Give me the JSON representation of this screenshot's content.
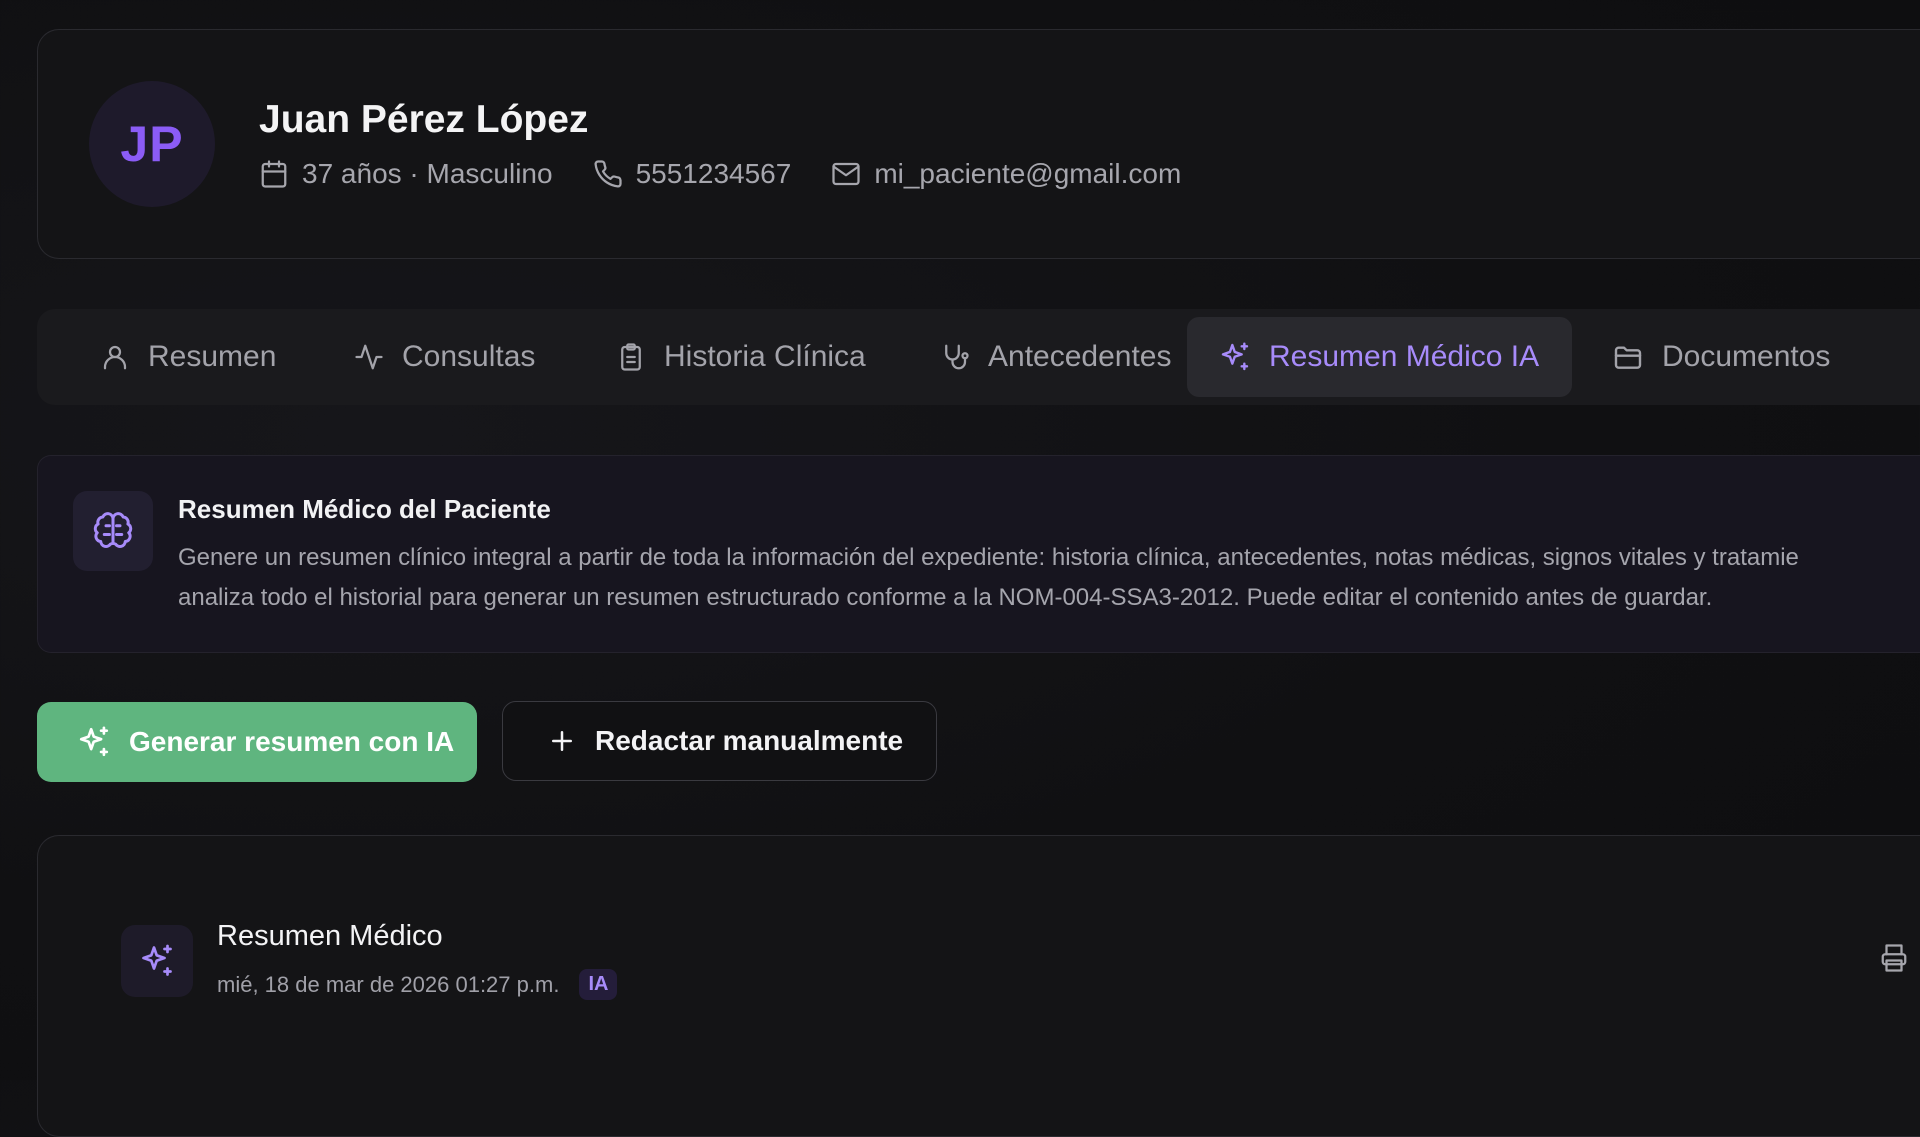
{
  "patient": {
    "initials": "JP",
    "name": "Juan Pérez López",
    "age_gender": "37 años · Masculino",
    "phone": "5551234567",
    "email": "mi_paciente@gmail.com"
  },
  "tabs": [
    {
      "label": "Resumen",
      "icon": "user-icon",
      "active": false
    },
    {
      "label": "Consultas",
      "icon": "activity-icon",
      "active": false
    },
    {
      "label": "Historia Clínica",
      "icon": "clipboard-icon",
      "active": false
    },
    {
      "label": "Antecedentes",
      "icon": "stethoscope-icon",
      "active": false
    },
    {
      "label": "Resumen Médico IA",
      "icon": "sparkles-icon",
      "active": true
    },
    {
      "label": "Documentos",
      "icon": "folder-icon",
      "active": false
    }
  ],
  "info": {
    "title": "Resumen Médico del Paciente",
    "line1": "Genere un resumen clínico integral a partir de toda la información del expediente: historia clínica, antecedentes, notas médicas, signos vitales y tratamie",
    "line2": "analiza todo el historial para generar un resumen estructurado conforme a la NOM-004-SSA3-2012. Puede editar el contenido antes de guardar."
  },
  "actions": {
    "generate_label": "Generar resumen con IA",
    "manual_label": "Redactar manualmente"
  },
  "summary": {
    "title": "Resumen Médico",
    "date": "mié, 18 de mar de 2026 01:27 p.m.",
    "badge": "IA"
  },
  "colors": {
    "accent": "#a78bfa",
    "primary_button": "#5fb57f",
    "background": "#101012"
  }
}
